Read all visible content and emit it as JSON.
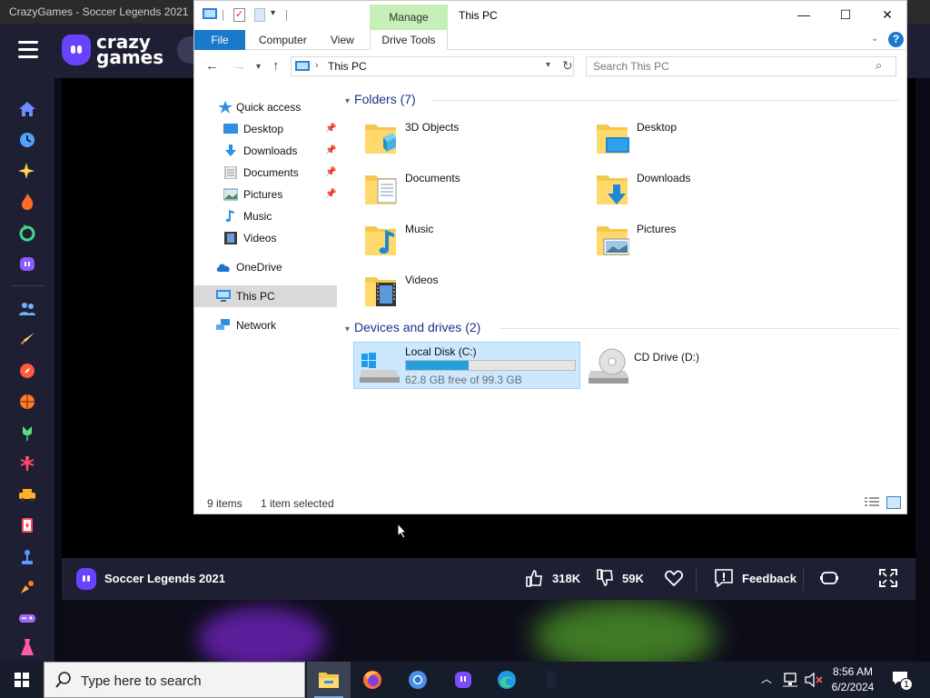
{
  "browser": {
    "tab_title": "CrazyGames - Soccer Legends 2021"
  },
  "crazygames": {
    "logo_text_top": "crazy",
    "logo_text_bottom": "games",
    "game_title": "Soccer Legends 2021",
    "likes": "318K",
    "dislikes": "59K",
    "feedback_label": "Feedback"
  },
  "explorer": {
    "window_title": "This PC",
    "contextual_tab": "Manage",
    "ribbon_tabs": [
      "File",
      "Computer",
      "View",
      "Drive Tools"
    ],
    "address_path": "This PC",
    "search_placeholder": "Search This PC",
    "nav_pane": [
      {
        "label": "Quick access",
        "icon": "star-icon"
      },
      {
        "label": "Desktop",
        "icon": "desktop-icon",
        "pinned": true
      },
      {
        "label": "Downloads",
        "icon": "download-icon",
        "pinned": true
      },
      {
        "label": "Documents",
        "icon": "documents-icon",
        "pinned": true
      },
      {
        "label": "Pictures",
        "icon": "pictures-icon",
        "pinned": true
      },
      {
        "label": "Music",
        "icon": "music-icon"
      },
      {
        "label": "Videos",
        "icon": "videos-icon"
      },
      {
        "label": "OneDrive",
        "icon": "cloud-icon"
      },
      {
        "label": "This PC",
        "icon": "computer-icon",
        "selected": true
      },
      {
        "label": "Network",
        "icon": "network-icon"
      }
    ],
    "folders_header": "Folders (7)",
    "folders": [
      {
        "name": "3D Objects",
        "icon": "3d-objects-icon"
      },
      {
        "name": "Desktop",
        "icon": "desktop-folder-icon"
      },
      {
        "name": "Documents",
        "icon": "documents-folder-icon"
      },
      {
        "name": "Downloads",
        "icon": "downloads-folder-icon"
      },
      {
        "name": "Music",
        "icon": "music-folder-icon"
      },
      {
        "name": "Pictures",
        "icon": "pictures-folder-icon"
      },
      {
        "name": "Videos",
        "icon": "videos-folder-icon"
      }
    ],
    "devices_header": "Devices and drives (2)",
    "drives": [
      {
        "name": "Local Disk (C:)",
        "free_text": "62.8 GB free of 99.3 GB",
        "used_fraction": 0.37,
        "selected": true
      },
      {
        "name": "CD Drive (D:)"
      }
    ],
    "status_items": "9 items",
    "status_selected": "1 item selected"
  },
  "taskbar": {
    "search_placeholder": "Type here to search",
    "time": "8:56 AM",
    "date": "6/2/2024",
    "notification_count": "1"
  },
  "colors": {
    "explorer_accent": "#1979ca",
    "manage_tab": "#c5efb6",
    "selected_drive": "#cce8ff",
    "drive_bar_fill": "#26a0da",
    "crazygames_purple": "#6842ff"
  }
}
